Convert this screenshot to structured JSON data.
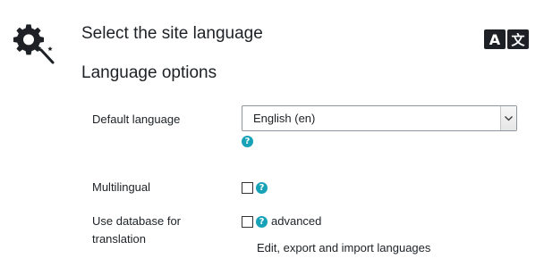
{
  "header": {
    "title": "Select the site language",
    "settings_icon": "gear-wand-icon",
    "language_icon": "translate-icon",
    "language_icon_glyphs": [
      "A",
      "文"
    ]
  },
  "section": {
    "title": "Language options"
  },
  "fields": {
    "default_language": {
      "label": "Default language",
      "value": "English (en)",
      "help": "?"
    },
    "multilingual": {
      "label": "Multilingual",
      "checked": false,
      "help": "?"
    },
    "use_database": {
      "label": "Use database for translation",
      "checked": false,
      "help": "?",
      "note": "advanced"
    }
  },
  "links": {
    "edit_languages": "Edit, export and import languages"
  },
  "colors": {
    "help_icon": "#17a2b8",
    "text": "#1d2125"
  }
}
